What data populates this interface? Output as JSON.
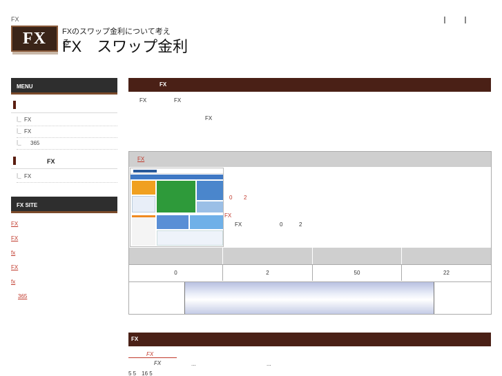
{
  "header": {
    "top_label": "FX",
    "logo_mark": "FX",
    "logo_subtitle": "FXのスワップ金利について考える",
    "logo_title": "FX　スワップ金利"
  },
  "sidebar": {
    "menu_title": "MENU",
    "category1": "",
    "items1": [
      "FX",
      "FX",
      "365"
    ],
    "category2": "FX",
    "items2": [
      "FX"
    ],
    "site_title": "FX SITE",
    "site_links": [
      "FX",
      "FX",
      "fx",
      "FX",
      "fx",
      "365"
    ]
  },
  "main": {
    "section_title": "FX",
    "intro_line1_a": "FX",
    "intro_line1_b": "FX",
    "intro_line2": "FX",
    "card": {
      "link": "FX",
      "red_a": "0",
      "red_b": "2",
      "red_fx": "FX",
      "desc_fx": "FX",
      "desc_a": "0",
      "desc_b": "2",
      "values": [
        "0",
        "2",
        "50",
        "22"
      ]
    },
    "news_title": "FX",
    "news_link": "FX",
    "news_item_fx": "FX",
    "news_dots1": "...",
    "news_dots2": "...",
    "news_date": "5 5　16 5"
  }
}
